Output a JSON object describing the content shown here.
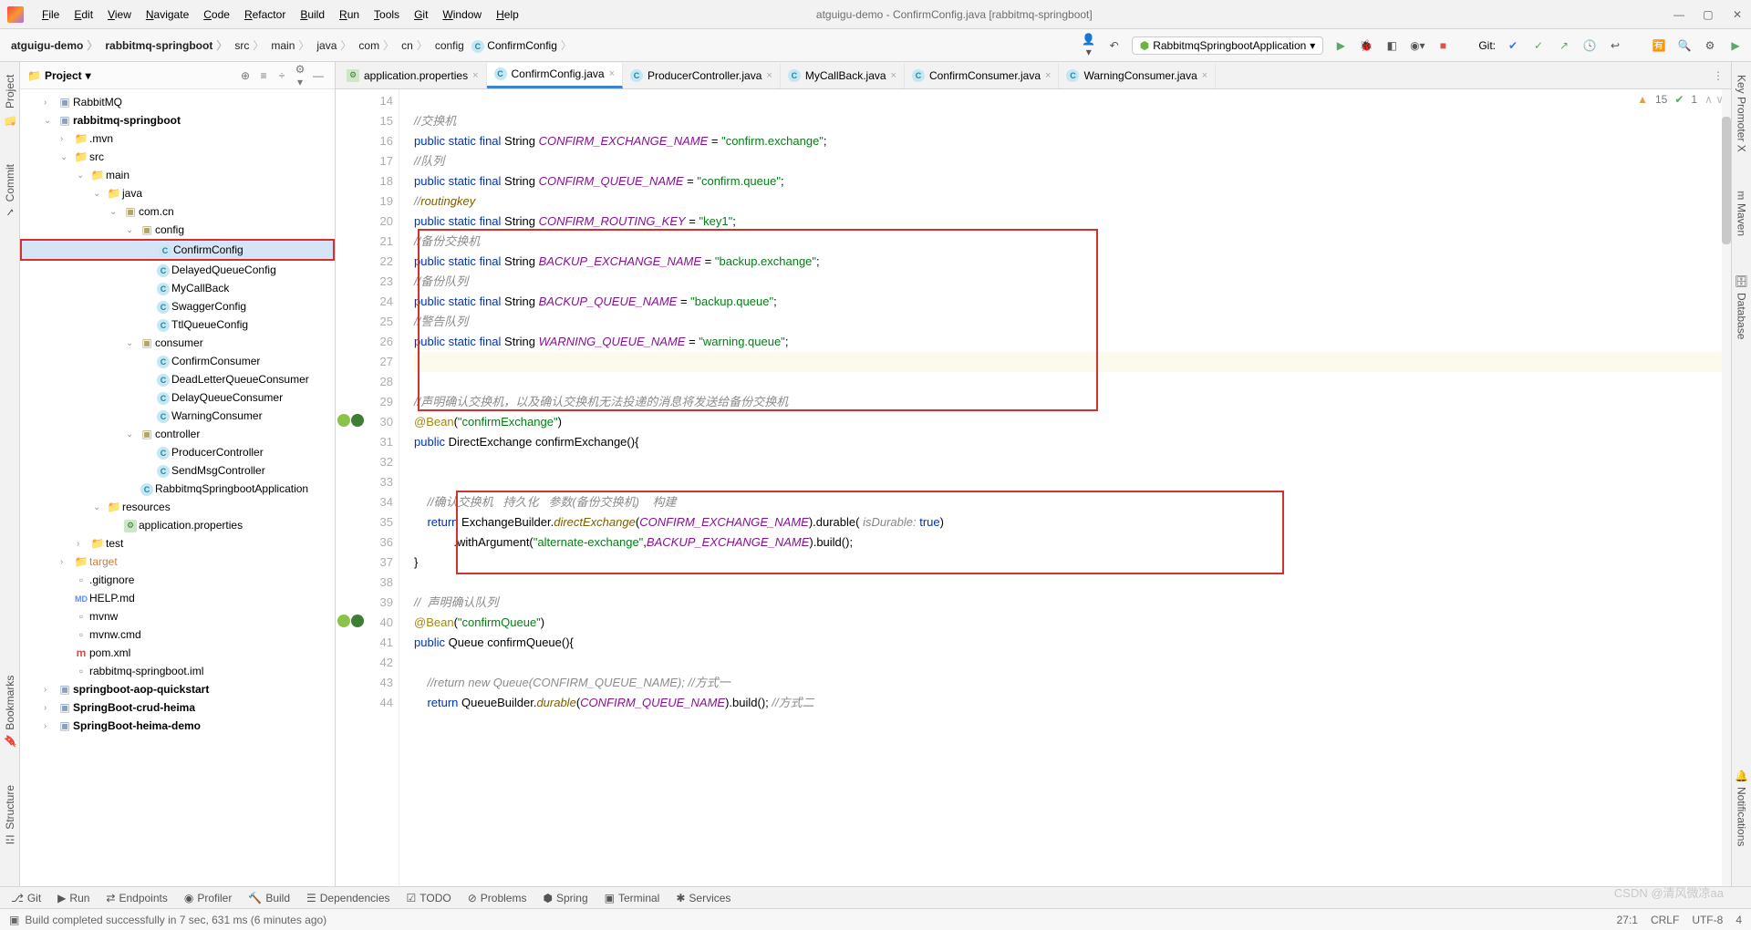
{
  "menus": [
    "File",
    "Edit",
    "View",
    "Navigate",
    "Code",
    "Refactor",
    "Build",
    "Run",
    "Tools",
    "Git",
    "Window",
    "Help"
  ],
  "window_title": "atguigu-demo - ConfirmConfig.java [rabbitmq-springboot]",
  "breadcrumbs": [
    "atguigu-demo",
    "rabbitmq-springboot",
    "src",
    "main",
    "java",
    "com",
    "cn",
    "config"
  ],
  "breadcrumb_last": "ConfirmConfig",
  "run_config": "RabbitmqSpringbootApplication",
  "git_label": "Git:",
  "side_left": [
    "Project",
    "Commit",
    "Bookmarks",
    "Structure"
  ],
  "side_right": [
    "Key Promoter X",
    "Maven",
    "Database",
    "Notifications"
  ],
  "tree_title": "Project",
  "tree": [
    {
      "depth": 1,
      "chev": "›",
      "icon": "mod",
      "label": "RabbitMQ",
      "cls": ""
    },
    {
      "depth": 1,
      "chev": "⌄",
      "icon": "mod",
      "label": "rabbitmq-springboot",
      "bold": true
    },
    {
      "depth": 2,
      "chev": "›",
      "icon": "folder",
      "label": ".mvn"
    },
    {
      "depth": 2,
      "chev": "⌄",
      "icon": "folder-blue",
      "label": "src"
    },
    {
      "depth": 3,
      "chev": "⌄",
      "icon": "folder-blue",
      "label": "main"
    },
    {
      "depth": 4,
      "chev": "⌄",
      "icon": "folder-blue",
      "label": "java"
    },
    {
      "depth": 5,
      "chev": "⌄",
      "icon": "pkg",
      "label": "com.cn"
    },
    {
      "depth": 6,
      "chev": "⌄",
      "icon": "pkg",
      "label": "config"
    },
    {
      "depth": 7,
      "chev": "",
      "icon": "class",
      "label": "ConfirmConfig",
      "selected": true
    },
    {
      "depth": 7,
      "chev": "",
      "icon": "class",
      "label": "DelayedQueueConfig"
    },
    {
      "depth": 7,
      "chev": "",
      "icon": "class",
      "label": "MyCallBack"
    },
    {
      "depth": 7,
      "chev": "",
      "icon": "class",
      "label": "SwaggerConfig"
    },
    {
      "depth": 7,
      "chev": "",
      "icon": "class",
      "label": "TtlQueueConfig"
    },
    {
      "depth": 6,
      "chev": "⌄",
      "icon": "pkg",
      "label": "consumer"
    },
    {
      "depth": 7,
      "chev": "",
      "icon": "class",
      "label": "ConfirmConsumer"
    },
    {
      "depth": 7,
      "chev": "",
      "icon": "class",
      "label": "DeadLetterQueueConsumer"
    },
    {
      "depth": 7,
      "chev": "",
      "icon": "class",
      "label": "DelayQueueConsumer"
    },
    {
      "depth": 7,
      "chev": "",
      "icon": "class",
      "label": "WarningConsumer"
    },
    {
      "depth": 6,
      "chev": "⌄",
      "icon": "pkg",
      "label": "controller"
    },
    {
      "depth": 7,
      "chev": "",
      "icon": "class",
      "label": "ProducerController"
    },
    {
      "depth": 7,
      "chev": "",
      "icon": "class",
      "label": "SendMsgController"
    },
    {
      "depth": 6,
      "chev": "",
      "icon": "class-sp",
      "label": "RabbitmqSpringbootApplication"
    },
    {
      "depth": 4,
      "chev": "⌄",
      "icon": "folder-res",
      "label": "resources"
    },
    {
      "depth": 5,
      "chev": "",
      "icon": "prop",
      "label": "application.properties"
    },
    {
      "depth": 3,
      "chev": "›",
      "icon": "folder-green",
      "label": "test"
    },
    {
      "depth": 2,
      "chev": "›",
      "icon": "folder-target",
      "label": "target"
    },
    {
      "depth": 2,
      "chev": "",
      "icon": "file",
      "label": ".gitignore"
    },
    {
      "depth": 2,
      "chev": "",
      "icon": "md",
      "label": "HELP.md"
    },
    {
      "depth": 2,
      "chev": "",
      "icon": "file",
      "label": "mvnw"
    },
    {
      "depth": 2,
      "chev": "",
      "icon": "file",
      "label": "mvnw.cmd"
    },
    {
      "depth": 2,
      "chev": "",
      "icon": "maven",
      "label": "pom.xml"
    },
    {
      "depth": 2,
      "chev": "",
      "icon": "file",
      "label": "rabbitmq-springboot.iml"
    },
    {
      "depth": 1,
      "chev": "›",
      "icon": "mod",
      "label": "springboot-aop-quickstart",
      "bold": true
    },
    {
      "depth": 1,
      "chev": "›",
      "icon": "mod",
      "label": "SpringBoot-crud-heima",
      "bold": true
    },
    {
      "depth": 1,
      "chev": "›",
      "icon": "mod",
      "label": "SpringBoot-heima-demo",
      "bold": true
    }
  ],
  "tabs": [
    {
      "icon": "prop",
      "label": "application.properties"
    },
    {
      "icon": "class",
      "label": "ConfirmConfig.java",
      "active": true
    },
    {
      "icon": "class",
      "label": "ProducerController.java"
    },
    {
      "icon": "class",
      "label": "MyCallBack.java"
    },
    {
      "icon": "class",
      "label": "ConfirmConsumer.java"
    },
    {
      "icon": "class",
      "label": "WarningConsumer.java"
    }
  ],
  "inspections": {
    "warn": "15",
    "ok": "1",
    "arrows": "^ v"
  },
  "lines": [
    14,
    15,
    16,
    17,
    18,
    19,
    20,
    21,
    22,
    23,
    24,
    25,
    26,
    27,
    28,
    29,
    30,
    31,
    32,
    33,
    34,
    35,
    36,
    37,
    38,
    39,
    40,
    41,
    42,
    43,
    44
  ],
  "gutter_icons": {
    "30": true,
    "40": true
  },
  "code": {
    "l14": "",
    "l15_c": "//交换机",
    "l16_pre": "public static final String ",
    "l16_const": "CONFIRM_EXCHANGE_NAME",
    "l16_eq": " = ",
    "l16_str": "\"confirm.exchange\"",
    "l16_end": ";",
    "l17_c": "//队列",
    "l18_const": "CONFIRM_QUEUE_NAME",
    "l18_str": "\"confirm.queue\"",
    "l19_c": "//routingkey",
    "l20_const": "CONFIRM_ROUTING_KEY",
    "l20_str": "\"key1\"",
    "l21_c": "//备份交换机",
    "l22_const": "BACKUP_EXCHANGE_NAME",
    "l22_str": "\"backup.exchange\"",
    "l23_c": "//备份队列",
    "l24_const": "BACKUP_QUEUE_NAME",
    "l24_str": "\"backup.queue\"",
    "l25_c": "//警告队列",
    "l26_const": "WARNING_QUEUE_NAME",
    "l26_str": "\"warning.queue\"",
    "l29_c": "//声明确认交换机，以及确认交换机无法投递的消息将发送给备份交换机",
    "l30_ann": "@Bean",
    "l30_str": "\"confirmExchange\"",
    "l31": "public DirectExchange confirmExchange(){",
    "l34_c": "//确认交换机   持久化   参数(备份交换机)    构建",
    "l35": "return ExchangeBuilder.directExchange(CONFIRM_EXCHANGE_NAME).durable( isDurable: true)",
    "l36": ".withArgument(\"alternate-exchange\",BACKUP_EXCHANGE_NAME).build();",
    "l39_c": "//  声明确认队列",
    "l40_str": "\"confirmQueue\"",
    "l41": "public Queue confirmQueue(){",
    "l43_c": "//return new Queue(CONFIRM_QUEUE_NAME); //方式一",
    "l44": "return QueueBuilder.durable(CONFIRM_QUEUE_NAME).build(); //方式二"
  },
  "bottom_tabs": [
    "Git",
    "Run",
    "Endpoints",
    "Profiler",
    "Build",
    "Dependencies",
    "TODO",
    "Problems",
    "Spring",
    "Terminal",
    "Services"
  ],
  "status_msg": "Build completed successfully in 7 sec, 631 ms (6 minutes ago)",
  "status_right": {
    "pos": "27:1",
    "eol": "CRLF",
    "enc": "UTF-8",
    "spaces": "4"
  },
  "watermark": "CSDN @清风微凉aa"
}
